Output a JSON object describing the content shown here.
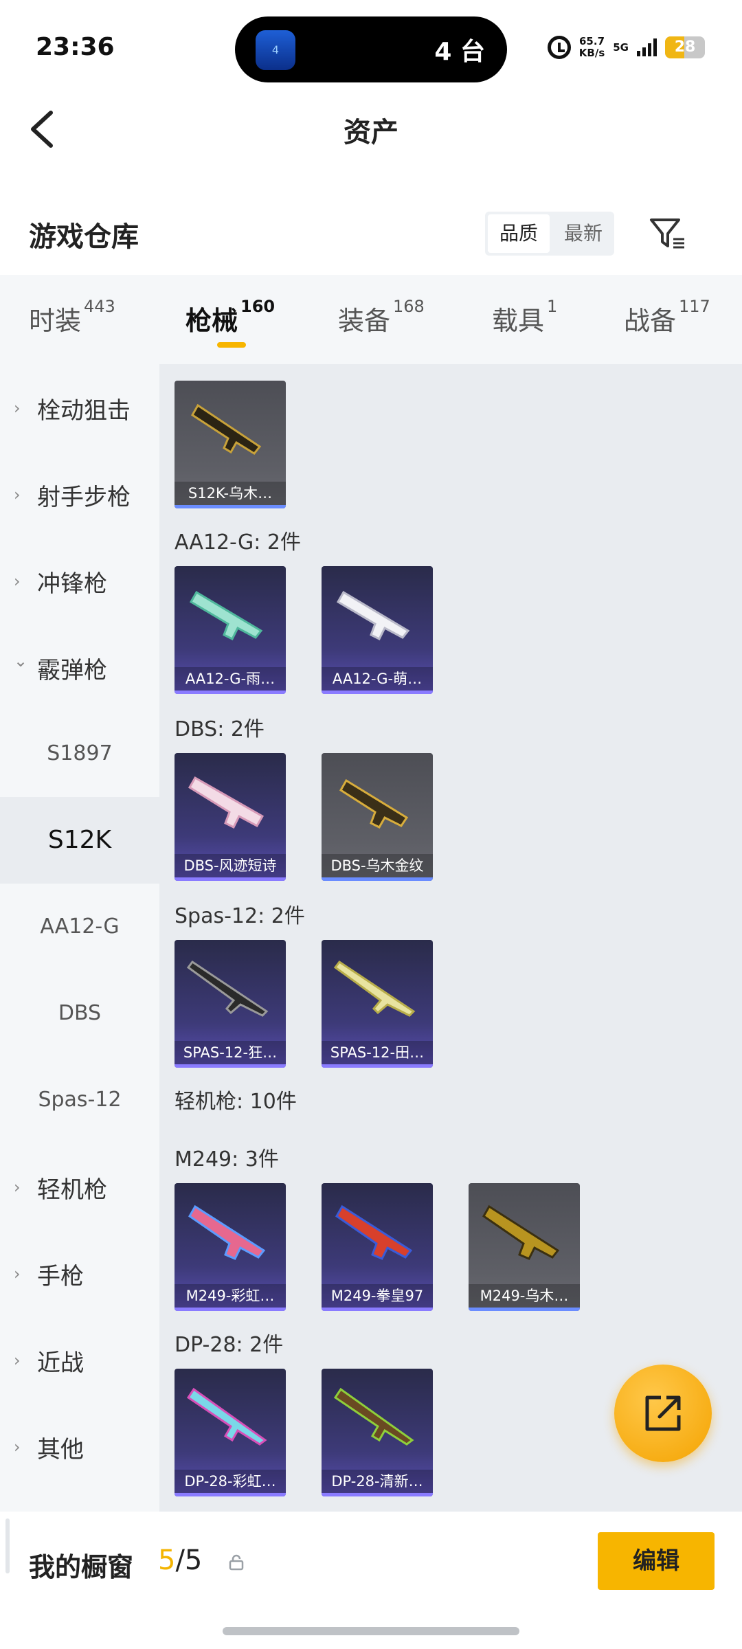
{
  "status_bar": {
    "time": "23:36",
    "island_app_label": "4",
    "island_text": "4 台",
    "speed_value": "65.7",
    "speed_unit": "KB/s",
    "network": "5G",
    "battery": "28"
  },
  "nav": {
    "title": "资产",
    "back_icon": "chevron-left-icon"
  },
  "warehouse": {
    "title": "游戏仓库",
    "sort_options": [
      "品质",
      "最新"
    ],
    "filter_icon": "filter-icon"
  },
  "tabs": [
    {
      "label": "时装",
      "count": "443"
    },
    {
      "label": "枪械",
      "count": "160"
    },
    {
      "label": "装备",
      "count": "168"
    },
    {
      "label": "载具",
      "count": "1"
    },
    {
      "label": "战备",
      "count": "117"
    }
  ],
  "sidebar": {
    "categories": [
      {
        "label": "栓动狙击",
        "chevron": "›"
      },
      {
        "label": "射手步枪",
        "chevron": "›"
      },
      {
        "label": "冲锋枪",
        "chevron": "›"
      },
      {
        "label": "霰弹枪",
        "chevron": "⌄"
      }
    ],
    "subitems": [
      "S1897",
      "S12K",
      "AA12-G",
      "DBS",
      "Spas-12"
    ],
    "categories_after": [
      {
        "label": "轻机枪",
        "chevron": "›"
      },
      {
        "label": "手枪",
        "chevron": "›"
      },
      {
        "label": "近战",
        "chevron": "›"
      },
      {
        "label": "其他",
        "chevron": "›"
      }
    ]
  },
  "content": {
    "groups": [
      {
        "label": "",
        "items": [
          {
            "name": "S12K-乌木…",
            "rarity_color": "#6a8cff"
          }
        ]
      },
      {
        "label": "AA12-G: 2件",
        "items": [
          {
            "name": "AA12-G-雨…",
            "rarity_color": "#8a7bff"
          },
          {
            "name": "AA12-G-萌…",
            "rarity_color": "#8a7bff"
          }
        ]
      },
      {
        "label": "DBS: 2件",
        "items": [
          {
            "name": "DBS-风迹短诗",
            "rarity_color": "#8a7bff"
          },
          {
            "name": "DBS-乌木金纹",
            "rarity_color": "#6a8cff"
          }
        ]
      },
      {
        "label": "Spas-12: 2件",
        "items": [
          {
            "name": "SPAS-12-狂…",
            "rarity_color": "#8a7bff"
          },
          {
            "name": "SPAS-12-田…",
            "rarity_color": "#8a7bff"
          }
        ]
      },
      {
        "label": "轻机枪: 10件",
        "items": []
      },
      {
        "label": "M249: 3件",
        "items": [
          {
            "name": "M249-彩虹…",
            "rarity_color": "#8a7bff"
          },
          {
            "name": "M249-拳皇97",
            "rarity_color": "#8a7bff"
          },
          {
            "name": "M249-乌木…",
            "rarity_color": "#6a8cff"
          }
        ]
      },
      {
        "label": "DP-28: 2件",
        "items": [
          {
            "name": "DP-28-彩虹…",
            "rarity_color": "#8a7bff"
          },
          {
            "name": "DP-28-清新…",
            "rarity_color": "#8a7bff"
          }
        ]
      }
    ]
  },
  "fab": {
    "icon": "share-external-icon"
  },
  "bottom": {
    "title": "我的橱窗",
    "current": "5",
    "total": "/5",
    "lock_icon": "lock-icon",
    "edit_label": "编辑"
  },
  "colors": {
    "accent": "#f7b500",
    "sidebar_bg": "#f5f7f9",
    "content_bg": "#e9ecf0"
  }
}
